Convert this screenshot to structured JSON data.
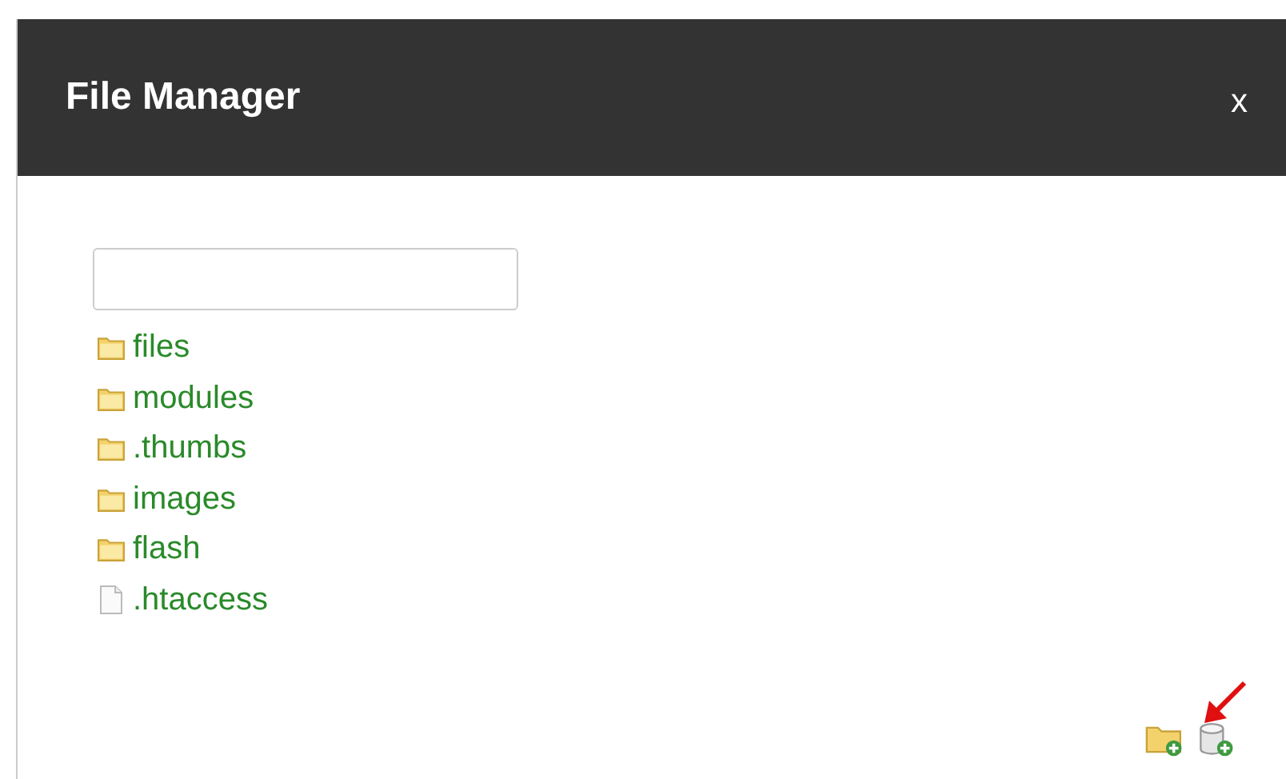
{
  "window": {
    "title": "File Manager",
    "close": "x"
  },
  "entries": [
    {
      "name": "files",
      "kind": "folder"
    },
    {
      "name": "modules",
      "kind": "folder"
    },
    {
      "name": ".thumbs",
      "kind": "folder"
    },
    {
      "name": "images",
      "kind": "folder"
    },
    {
      "name": "flash",
      "kind": "folder"
    },
    {
      "name": ".htaccess",
      "kind": "file"
    }
  ]
}
